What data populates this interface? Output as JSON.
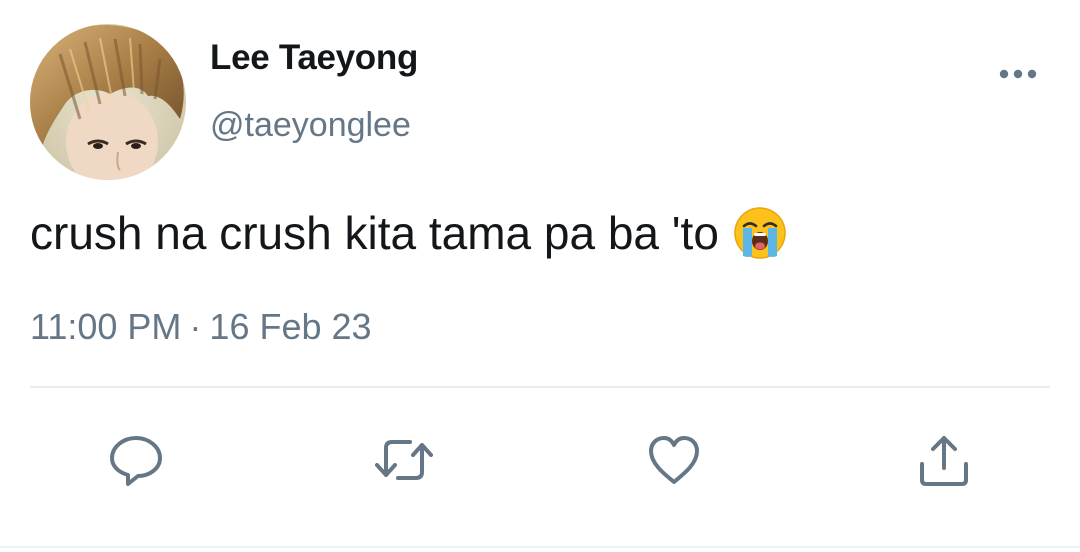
{
  "tweet": {
    "author": {
      "display_name": "Lee Taeyong",
      "handle": "@taeyonglee",
      "avatar_icon": "profile-photo"
    },
    "text": "crush na crush kita tama pa ba 'to",
    "emoji_icon": "loudly-crying-face-emoji",
    "time": "11:00 PM",
    "separator": "·",
    "date": "16 Feb 23"
  },
  "actions": [
    {
      "name": "reply",
      "icon": "speech-bubble-icon"
    },
    {
      "name": "retweet",
      "icon": "retweet-arrows-icon"
    },
    {
      "name": "like",
      "icon": "heart-icon"
    },
    {
      "name": "share",
      "icon": "share-upload-icon"
    }
  ],
  "colors": {
    "text_primary": "#14171a",
    "text_secondary": "#657786",
    "icon": "#657786",
    "divider": "#e6ecf0"
  }
}
